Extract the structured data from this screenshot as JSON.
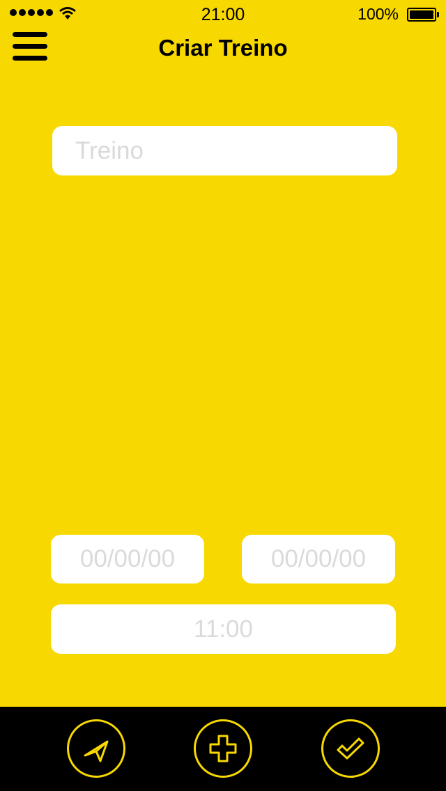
{
  "status_bar": {
    "time": "21:00",
    "battery": "100%"
  },
  "header": {
    "title": "Criar Treino",
    "menu_icon": "hamburger-menu-icon"
  },
  "form": {
    "workout_name_placeholder": "Treino",
    "start_date_placeholder": "00/00/00",
    "end_date_placeholder": "00/00/00",
    "time_placeholder": "11:00"
  },
  "bottom_bar": {
    "buttons": [
      {
        "icon": "send-icon"
      },
      {
        "icon": "plus-icon"
      },
      {
        "icon": "check-icon"
      }
    ]
  },
  "colors": {
    "background": "#F7D800",
    "bar": "#000000",
    "accent": "#F7D800",
    "field": "#FFFFFF",
    "placeholder": "#DADADA"
  }
}
